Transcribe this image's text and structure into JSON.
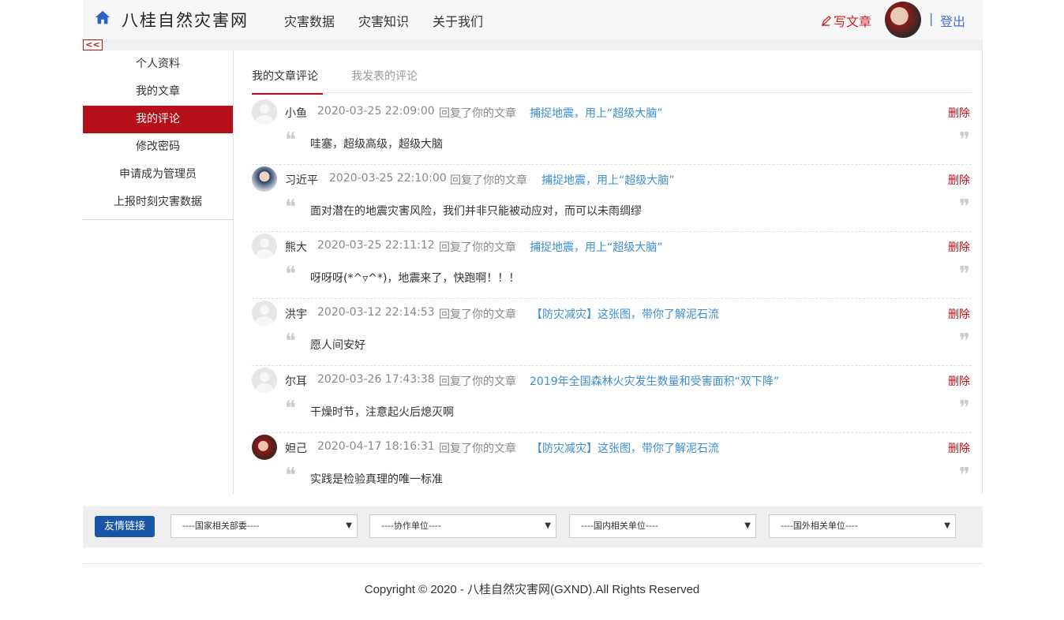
{
  "header": {
    "site_title": "八桂自然灾害网",
    "nav": [
      "灾害数据",
      "灾害知识",
      "关于我们"
    ],
    "write_label": "写文章",
    "separator": "|",
    "logout_label": "登出"
  },
  "collapse_label": "<<",
  "sidebar": {
    "items": [
      "个人资料",
      "我的文章",
      "我的评论",
      "修改密码",
      "申请成为管理员",
      "上报时刻灾害数据"
    ],
    "active_index": 2
  },
  "tabs": {
    "active": "我的文章评论",
    "other": "我发表的评论"
  },
  "comments": [
    {
      "name": "小鱼",
      "time": "2020-03-25 22:09:00",
      "reply": "回复了你的文章",
      "article": "捕捉地震，用上“超级大脑”",
      "delete": "删除",
      "content": "哇塞，超级高级，超级大脑"
    },
    {
      "name": "习近平",
      "time": "2020-03-25 22:10:00",
      "reply": "回复了你的文章",
      "article": "捕捉地震，用上“超级大脑”",
      "delete": "删除",
      "content": "面对潜在的地震灾害风险，我们并非只能被动应对，而可以未雨绸缪"
    },
    {
      "name": "熊大",
      "time": "2020-03-25 22:11:12",
      "reply": "回复了你的文章",
      "article": "捕捉地震，用上“超级大脑”",
      "delete": "删除",
      "content": "呀呀呀(*^▿^*)，地震来了，快跑啊！！！"
    },
    {
      "name": "洪宇",
      "time": "2020-03-12 22:14:53",
      "reply": "回复了你的文章",
      "article": "【防灾减灾】这张图，带你了解泥石流",
      "delete": "删除",
      "content": "愿人间安好"
    },
    {
      "name": "尔耳",
      "time": "2020-03-26 17:43:38",
      "reply": "回复了你的文章",
      "article": "2019年全国森林火灾发生数量和受害面积“双下降”",
      "delete": "删除",
      "content": "干燥时节，注意起火后熄灭啊"
    },
    {
      "name": "妲己",
      "time": "2020-04-17 18:16:31",
      "reply": "回复了你的文章",
      "article": "【防灾减灾】这张图，带你了解泥石流",
      "delete": "删除",
      "content": "实践是检验真理的唯一标准"
    }
  ],
  "quote_open": "❝",
  "quote_close": "❞",
  "links": {
    "button": "友情链接",
    "selects": [
      "----国家相关部委----",
      "----协作单位----",
      "----国内相关单位----",
      "----国外相关单位----"
    ]
  },
  "copyright": "Copyright © 2020 - 八桂自然灾害网(GXND).All Rights Reserved",
  "colors": {
    "brand_red": "#b5101a",
    "link_blue": "#3b8ed0",
    "button_blue": "#1a56a8"
  }
}
